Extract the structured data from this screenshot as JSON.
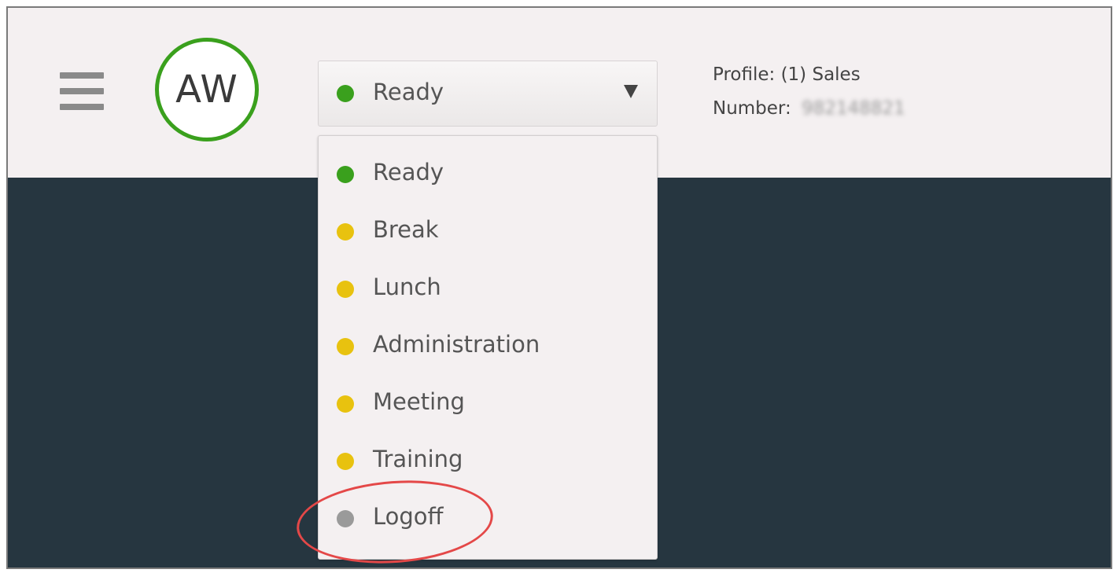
{
  "header": {
    "avatar_initials": "AW",
    "profile_text": "Profile: (1) Sales",
    "number_label": "Number:",
    "number_value": "982148821"
  },
  "status_select": {
    "selected_label": "Ready",
    "selected_color": "#3aa01d"
  },
  "status_menu": {
    "items": [
      {
        "label": "Ready",
        "color": "#3aa01d"
      },
      {
        "label": "Break",
        "color": "#e8c20f"
      },
      {
        "label": "Lunch",
        "color": "#e8c20f"
      },
      {
        "label": "Administration",
        "color": "#e8c20f"
      },
      {
        "label": "Meeting",
        "color": "#e8c20f"
      },
      {
        "label": "Training",
        "color": "#e8c20f"
      },
      {
        "label": "Logoff",
        "color": "#9a9a9a"
      }
    ]
  },
  "annotation": {
    "highlight_color": "#e44848"
  },
  "icons": {
    "menu": "hamburger-icon",
    "dropdown": "caret-down-icon"
  }
}
